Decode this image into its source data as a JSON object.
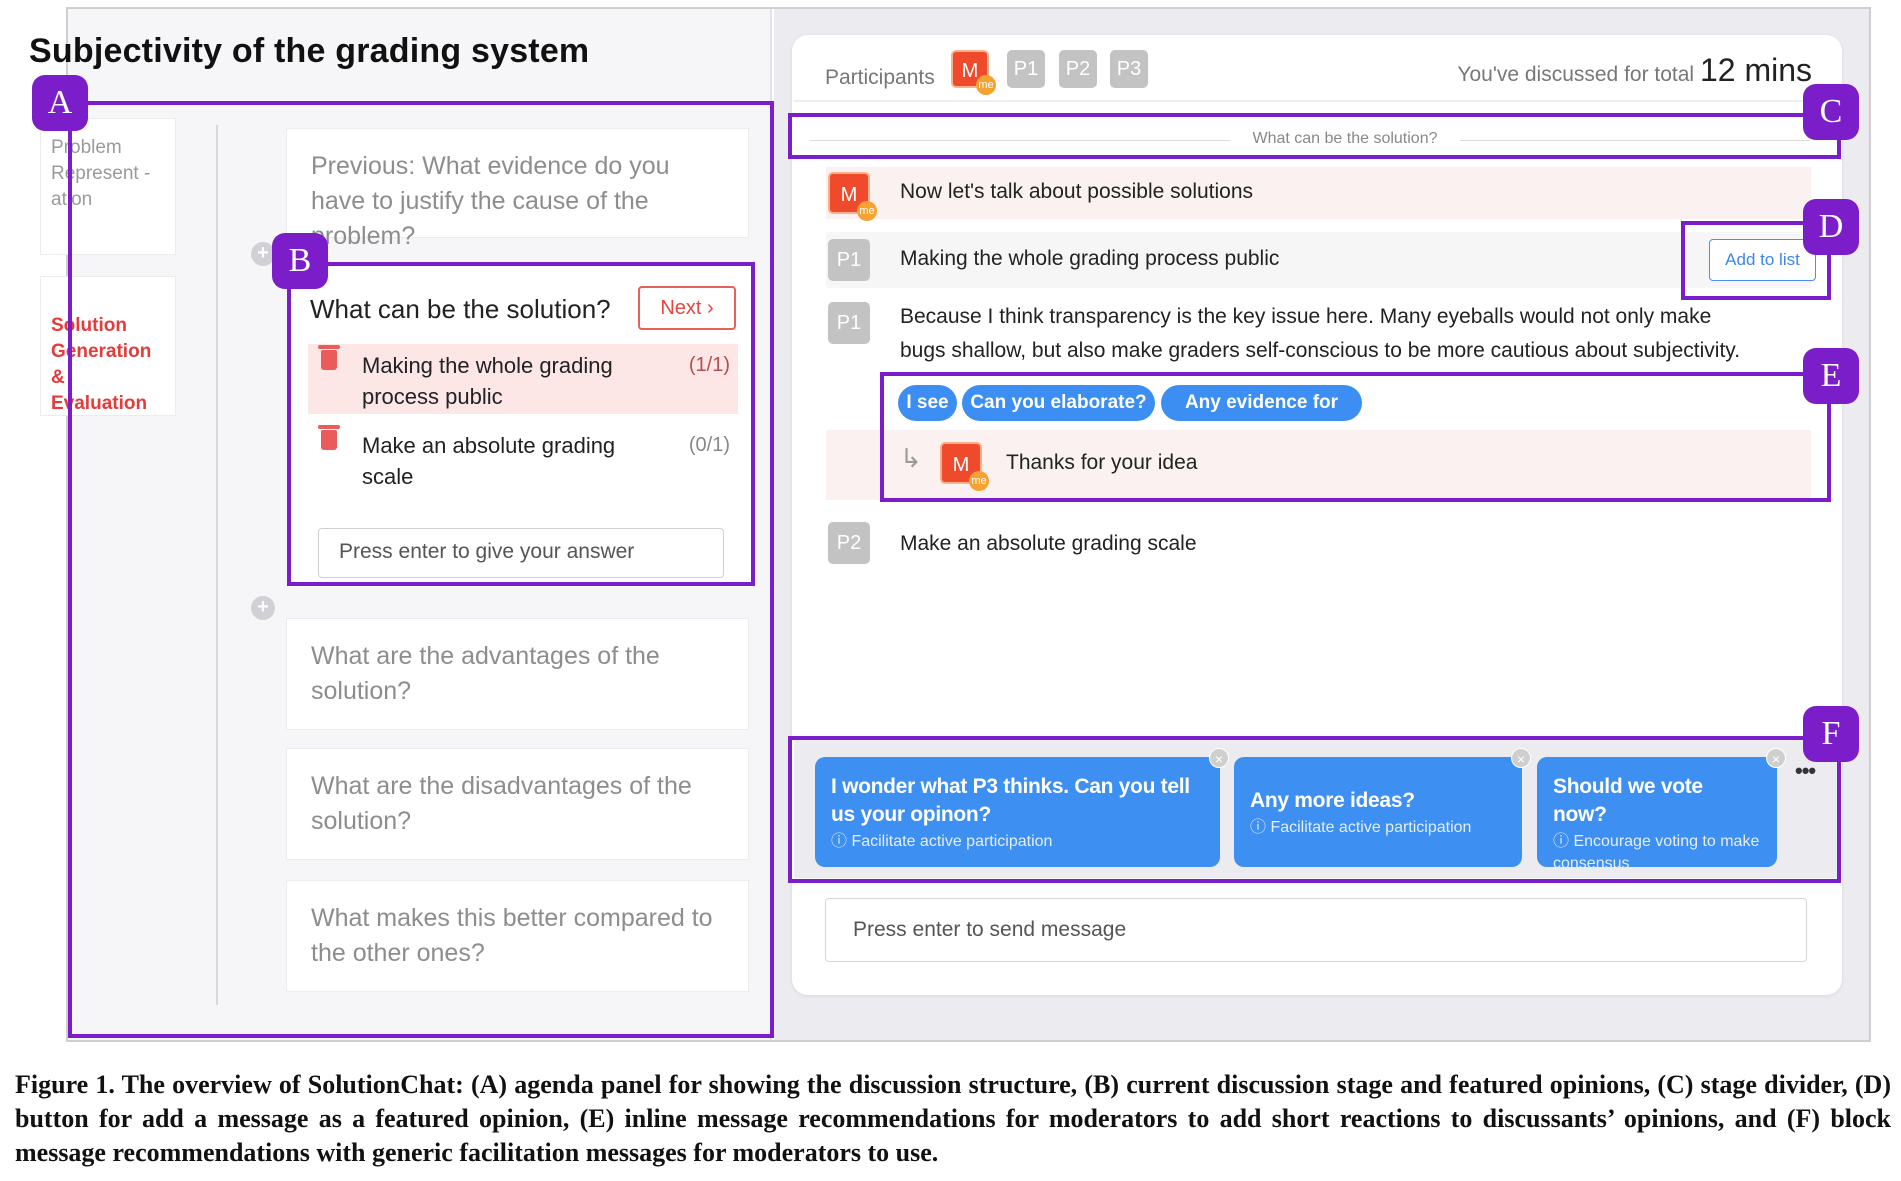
{
  "panel_title": "Subjectivity of the grading system",
  "agenda": {
    "tab_problem": "Problem Represent -ation",
    "tab_solution": "Solution Generation & Evaluation",
    "stages": {
      "previous": "Previous: What evidence do you have to justify the cause of the problem?",
      "advantages": "What are the advantages of the solution?",
      "disadvantages": "What are the disadvantages of the solution?",
      "better": "What makes this better compared to the other ones?"
    }
  },
  "current_stage": {
    "title": "What can be the solution?",
    "next_label": "Next",
    "opinions": [
      {
        "text": "Making the whole grading process public",
        "count": "(1/1)"
      },
      {
        "text": "Make an absolute grading scale",
        "count": "(0/1)"
      }
    ],
    "answer_placeholder": "Press enter to give your answer"
  },
  "chat": {
    "participants_label": "Participants",
    "participants": [
      "M",
      "P1",
      "P2",
      "P3"
    ],
    "me_badge": "me",
    "discussed_prefix": "You've discussed for total",
    "discussed_value": "12 mins",
    "divider_text": "What can be the solution?",
    "messages": [
      {
        "author": "M",
        "text": "Now let's talk about possible solutions"
      },
      {
        "author": "P1",
        "text": "Making the whole grading process public"
      },
      {
        "author": "P1",
        "text_line1": "Because I think transparency is the key issue here. Many eyeballs would not only make",
        "text_line2": "bugs shallow, but also make graders self-conscious to be more cautious about subjectivity."
      },
      {
        "author": "M",
        "text": "Thanks for your idea"
      },
      {
        "author": "P2",
        "text": "Make an absolute grading scale"
      }
    ],
    "add_to_list_label": "Add to list",
    "inline_chips": [
      "I see",
      "Can you elaborate?",
      "Any evidence for this?"
    ],
    "recommendations": [
      {
        "main": "I wonder what P3 thinks. Can you tell us your opinon?",
        "sub": "Facilitate active participation"
      },
      {
        "main": "Any more ideas?",
        "sub": "Facilitate active participation"
      },
      {
        "main": "Should we vote now?",
        "sub": "Encourage voting to make consensus"
      }
    ],
    "more_label": "•••",
    "send_placeholder": "Press enter to send message"
  },
  "annotations": [
    "A",
    "B",
    "C",
    "D",
    "E",
    "F"
  ],
  "caption": "Figure 1.  The overview of SolutionChat: (A) agenda panel for showing the discussion structure, (B) current discussion stage and featured opinions, (C) stage divider, (D) button for add a message as a featured opinion, (E) inline message recommendations for moderators to add short reactions to discussants’ opinions, and (F) block message recommendations with generic facilitation messages for moderators to use.",
  "colors": {
    "annotation": "#7b1ec9",
    "accent_blue": "#3d8ff2",
    "moderator": "#ef4a2c",
    "alert_red": "#e8453f"
  }
}
